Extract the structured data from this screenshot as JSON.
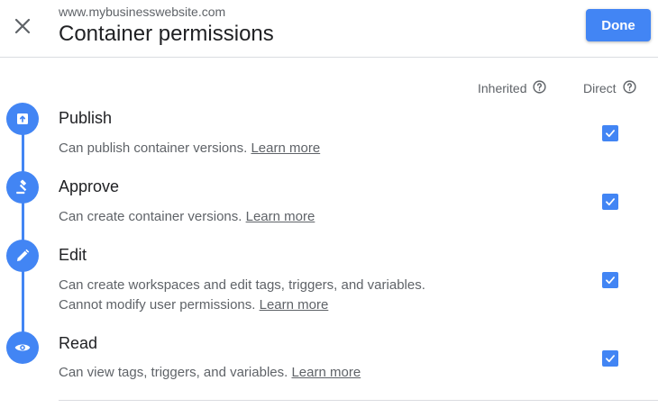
{
  "header": {
    "site_url": "www.mybusinesswebsite.com",
    "title": "Container permissions",
    "done_label": "Done",
    "close_icon": "close-icon"
  },
  "columns": {
    "inherited_label": "Inherited",
    "direct_label": "Direct"
  },
  "permissions": [
    {
      "title": "Publish",
      "desc": "Can publish container versions.",
      "desc2": "",
      "link": "Learn more",
      "icon": "publish-icon",
      "direct_checked": true
    },
    {
      "title": "Approve",
      "desc": "Can create container versions.",
      "desc2": "",
      "link": "Learn more",
      "icon": "gavel-icon",
      "direct_checked": true
    },
    {
      "title": "Edit",
      "desc": "Can create workspaces and edit tags, triggers, and variables.",
      "desc2": "Cannot modify user permissions.",
      "link": "Learn more",
      "icon": "pencil-icon",
      "direct_checked": true
    },
    {
      "title": "Read",
      "desc": "Can view tags, triggers, and variables.",
      "desc2": "",
      "link": "Learn more",
      "icon": "eye-icon",
      "direct_checked": true
    }
  ],
  "colors": {
    "accent": "#4285f4",
    "text": "#202124",
    "muted": "#5f6368",
    "divider": "#dadce0"
  }
}
